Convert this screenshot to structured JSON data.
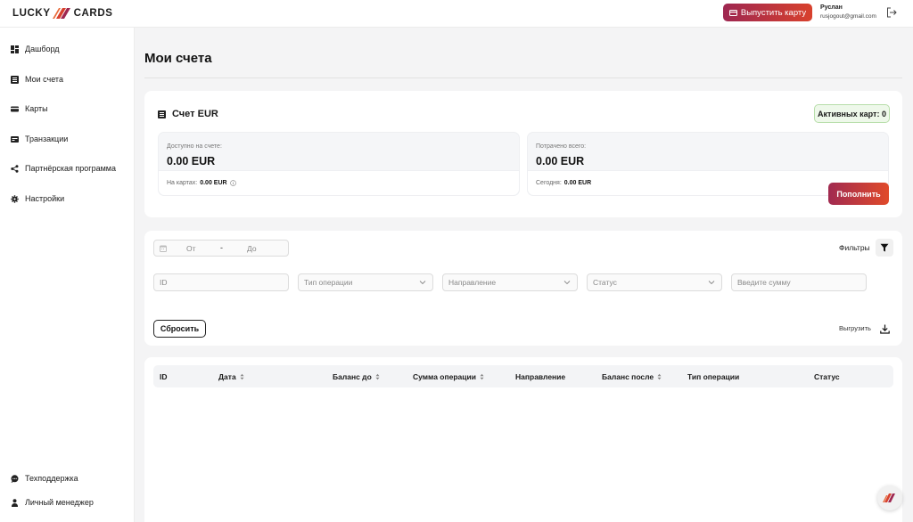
{
  "brand": {
    "left": "LUCKY",
    "right": "CARDS",
    "accent": "#d8412d",
    "accent_dark": "#9e2751"
  },
  "header": {
    "issue_card_label": "Выпустить карту",
    "user_name": "Руслан",
    "user_email": "rusjogout@gmail.com",
    "logout_icon": "logout-icon"
  },
  "sidebar": {
    "items": [
      {
        "label": "Дашборд",
        "icon": "dashboard-icon"
      },
      {
        "label": "Мои счета",
        "icon": "accounts-icon"
      },
      {
        "label": "Карты",
        "icon": "card-icon"
      },
      {
        "label": "Транзакции",
        "icon": "transactions-icon"
      },
      {
        "label": "Партнёрская программа",
        "icon": "share-icon"
      },
      {
        "label": "Настройки",
        "icon": "gear-icon"
      }
    ],
    "bottom_items": [
      {
        "label": "Техподдержка",
        "icon": "chat-icon"
      },
      {
        "label": "Личный менеджер",
        "icon": "person-icon"
      }
    ]
  },
  "page": {
    "title": "Мои счета"
  },
  "account": {
    "title": "Счет EUR",
    "active_cards": "Активных карт: 0",
    "available_label": "Доступно на счете:",
    "available_value": "0.00 EUR",
    "on_cards_label": "На картах:",
    "on_cards_value": "0.00 EUR",
    "spent_label": "Потрачено всего:",
    "spent_value": "0.00 EUR",
    "today_label": "Сегодня:",
    "today_value": "0.00 EUR",
    "topup_label": "Пополнить"
  },
  "filters": {
    "date_from": "От",
    "date_sep": "-",
    "date_to": "До",
    "filters_label": "Фильтры",
    "id_placeholder": "ID",
    "operation_type": "Тип операции",
    "direction": "Направление",
    "status": "Статус",
    "amount_placeholder": "Введите сумму",
    "reset_label": "Сбросить",
    "export_label": "Выгрузить"
  },
  "table": {
    "columns": [
      "ID",
      "Дата",
      "Баланс до",
      "Сумма операции",
      "Направление",
      "Баланс после",
      "Тип операции",
      "Статус"
    ],
    "rows": []
  }
}
